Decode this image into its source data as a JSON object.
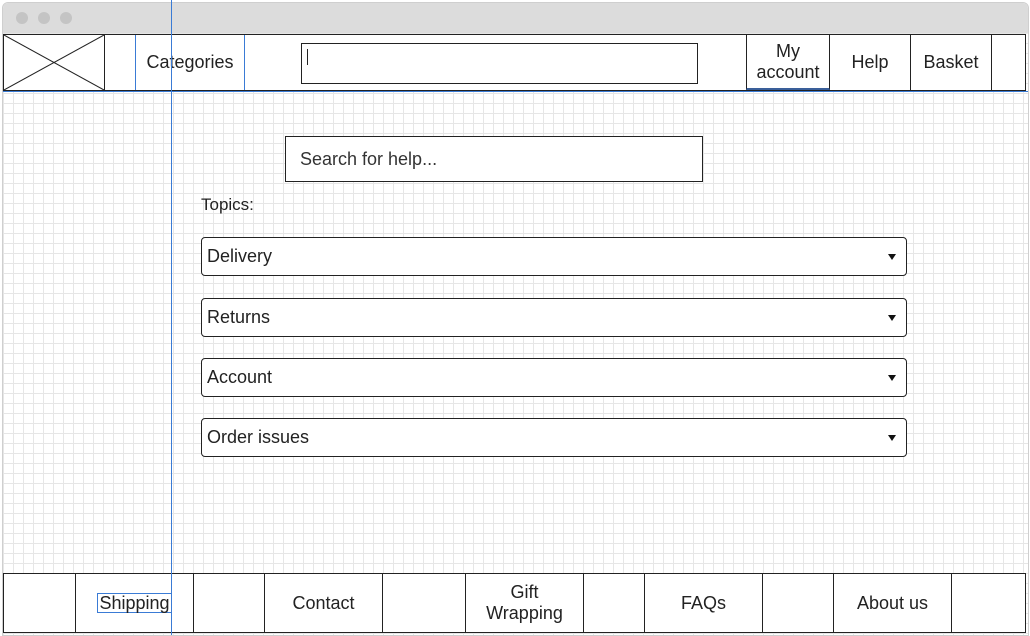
{
  "nav": {
    "categories": "Categories",
    "search_value": "",
    "my_account": "My account",
    "help": "Help",
    "basket": "Basket"
  },
  "help_search": {
    "placeholder": "Search for help..."
  },
  "topics": {
    "label": "Topics:",
    "items": [
      {
        "label": "Delivery"
      },
      {
        "label": "Returns"
      },
      {
        "label": "Account"
      },
      {
        "label": "Order issues"
      }
    ]
  },
  "footer": {
    "items": [
      {
        "label": "Shipping"
      },
      {
        "label": "Contact"
      },
      {
        "label": "Gift Wrapping"
      },
      {
        "label": "FAQs"
      },
      {
        "label": "About us"
      }
    ]
  },
  "colors": {
    "selection_accent": "#3a7bd5",
    "grid_line": "#e6e6e6",
    "border": "#222222"
  },
  "icons": {
    "logo": "image-placeholder-icon",
    "dropdown": "caret-down-icon"
  }
}
